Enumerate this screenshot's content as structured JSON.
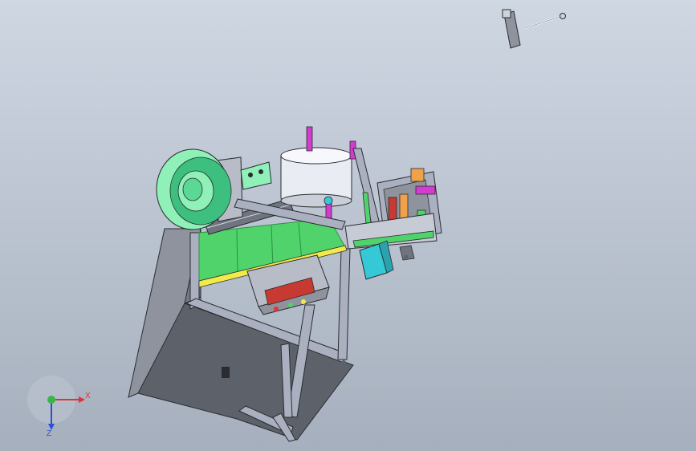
{
  "window": {
    "title": ""
  },
  "viewport": {
    "background_top": "#cfd7e3",
    "background_bottom": "#a6afbd"
  },
  "model": {
    "colors": {
      "frame": "#aab0bf",
      "cabinet_dark": "#5d616a",
      "cabinet_mid": "#8e939d",
      "green_panel": "#4fd36a",
      "green_edge": "#2f8f43",
      "yellow_strip": "#f2ea4a",
      "mint": "#8ff0b8",
      "mint_dark": "#3cbf7f",
      "drum": "#e9ecf3",
      "magenta": "#d43bd0",
      "cyan": "#35c8d6",
      "orange": "#f0a24a",
      "red_panel": "#c63a32"
    }
  },
  "triad": {
    "x_label": "X",
    "z_label": "Z",
    "x_color": "#e23232",
    "y_color": "#39b54a",
    "z_color": "#2b4fd6"
  }
}
